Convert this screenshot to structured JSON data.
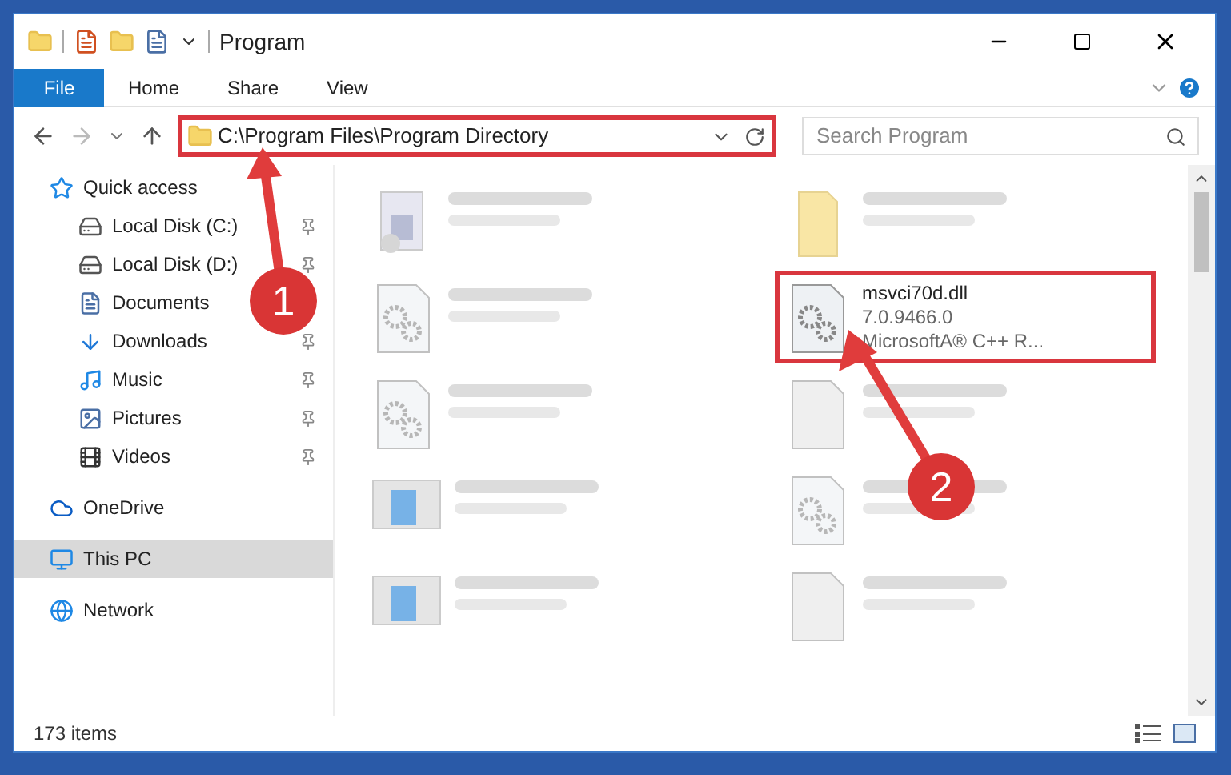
{
  "window": {
    "title": "Program"
  },
  "ribbon_tabs": [
    {
      "label": "File",
      "kind": "file"
    },
    {
      "label": "Home",
      "kind": "tab"
    },
    {
      "label": "Share",
      "kind": "tab"
    },
    {
      "label": "View",
      "kind": "tab"
    }
  ],
  "address_bar": {
    "path": "C:\\Program Files\\Program Directory",
    "highlighted": true
  },
  "search": {
    "placeholder": "Search Program"
  },
  "navigation": [
    {
      "label": "Quick access",
      "selected": false,
      "children": [
        {
          "label": "Local Disk (C:)",
          "pinned": true
        },
        {
          "label": "Local Disk (D:)",
          "pinned": true
        },
        {
          "label": "Documents"
        },
        {
          "label": "Downloads",
          "pinned": true
        },
        {
          "label": "Music",
          "pinned": true
        },
        {
          "label": "Pictures",
          "pinned": true
        },
        {
          "label": "Videos",
          "pinned": true
        }
      ]
    },
    {
      "label": "OneDrive",
      "selected": false
    },
    {
      "label": "This PC",
      "selected": true
    },
    {
      "label": "Network",
      "selected": false
    }
  ],
  "files": [
    {
      "kind": "program",
      "blurred": true,
      "highlighted": false
    },
    {
      "kind": "folder",
      "blurred": true,
      "highlighted": false
    },
    {
      "kind": "dll",
      "blurred": true,
      "highlighted": false
    },
    {
      "name": "msvci70d.dll",
      "details": [
        "7.0.9466.0",
        "MicrosoftA® C++ R..."
      ],
      "kind": "dll",
      "blurred": false,
      "highlighted": true
    },
    {
      "kind": "dll",
      "blurred": true,
      "highlighted": false
    },
    {
      "kind": "blank",
      "blurred": true,
      "highlighted": false
    },
    {
      "kind": "installer",
      "blurred": true,
      "highlighted": false
    },
    {
      "kind": "dll",
      "blurred": true,
      "highlighted": false
    },
    {
      "kind": "installer",
      "blurred": true,
      "highlighted": false
    },
    {
      "kind": "blank",
      "blurred": true,
      "highlighted": false
    }
  ],
  "status_bar": {
    "item_count": "173 items"
  },
  "annotations": [
    {
      "number": "1"
    },
    {
      "number": "2"
    }
  ]
}
